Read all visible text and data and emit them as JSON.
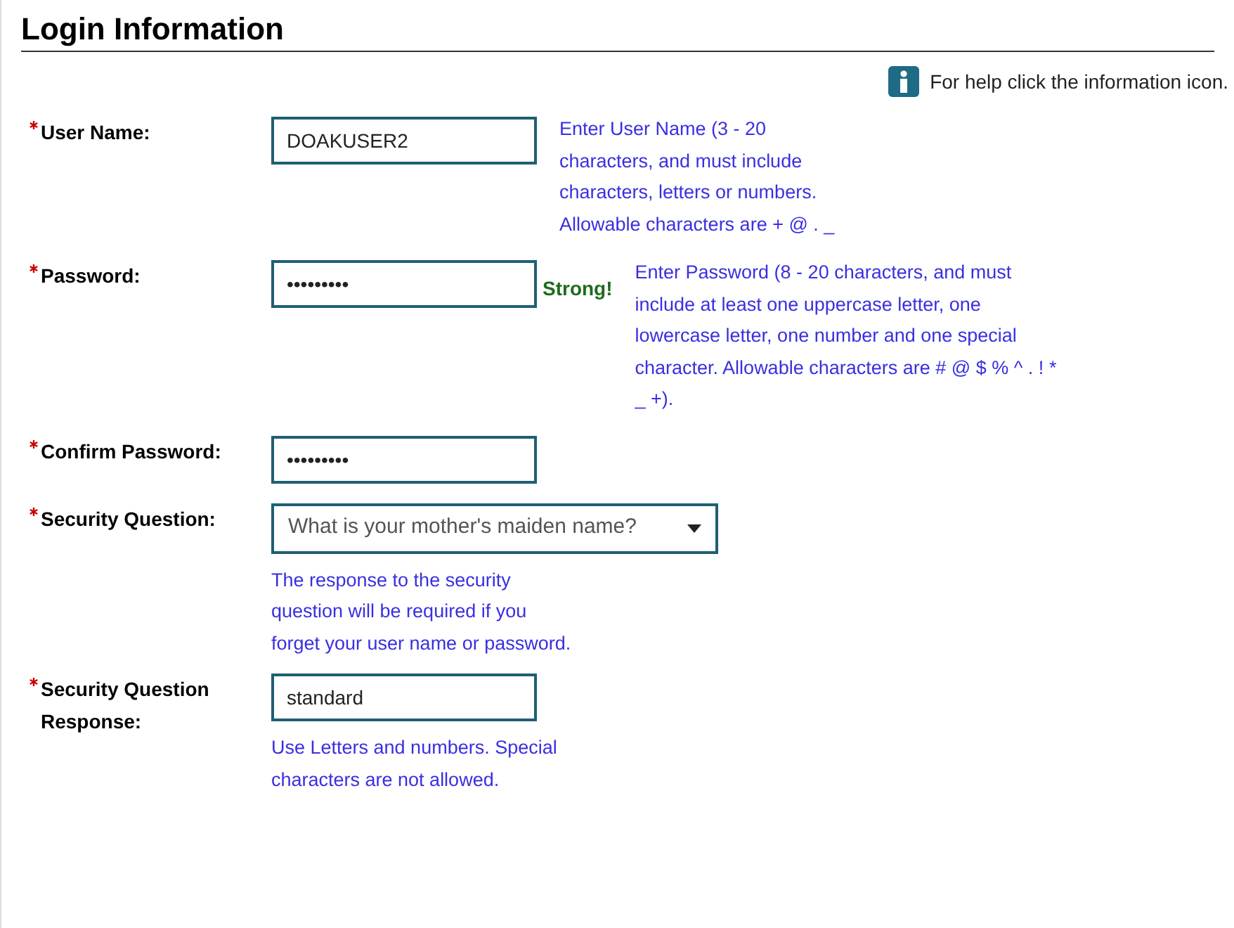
{
  "title": "Login Information",
  "help": {
    "text": "For help click the information icon."
  },
  "fields": [
    {
      "kind": "inline",
      "label": "User Name:",
      "required": true,
      "value": "DOAKUSER2",
      "hint": "Enter User Name (3 - 20 characters, and must include characters, letters or numbers. Allowable characters are + @ . _"
    },
    {
      "kind": "inline",
      "label": "Password:",
      "required": true,
      "value": "•••••••••",
      "strength": "Strong!",
      "hint": "Enter Password (8 - 20 characters, and must include at least one uppercase letter, one lowercase letter, one number and one special character. Allowable characters are # @ $ % ^ . ! * _ +)."
    },
    {
      "kind": "inline",
      "label": "Confirm Password:",
      "required": true,
      "value": "•••••••••"
    },
    {
      "kind": "select",
      "label": "Security Question:",
      "required": true,
      "value": "What is your mother's maiden name?",
      "hint": "The response to the security question will be required if you forget your user name or password."
    },
    {
      "kind": "stacked",
      "label": "Security Question Response:",
      "required": true,
      "value": "standard",
      "hint": "Use Letters and numbers. Special characters are not allowed."
    }
  ]
}
